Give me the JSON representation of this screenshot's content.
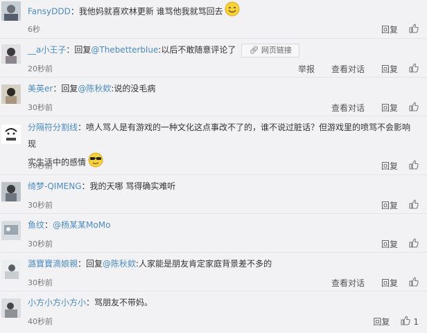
{
  "labels": {
    "reply": "回复",
    "report": "举报",
    "view_conversation": "查看对话"
  },
  "comments": [
    {
      "user": "FansyDDD",
      "text": "：我他妈就喜欢林更新 谁骂他我就骂回去",
      "time": "6秒",
      "emoji": "smile-emoji-icon"
    },
    {
      "user": "__a小王子",
      "prefix": "：回复",
      "mention": "@Thebetterblue",
      "text": ":以后不敢随意评论了",
      "link_label": "网页链接",
      "time": "20秒前"
    },
    {
      "user": "美英er",
      "prefix": "：回复",
      "mention": "@陈秋欸",
      "text": ":说的没毛病",
      "time": "30秒前"
    },
    {
      "user": "分隔符分割线",
      "text_line1": "：喷人骂人是有游戏的一种文化这点事改不了的，谁不说过脏话？但游戏里的喷骂不会影响现",
      "text_line2": "实生活中的感情",
      "emoji": "sunglasses-emoji-icon",
      "time": "30秒前"
    },
    {
      "user": "绮梦-QIMENG",
      "text": "：我的天哪 骂得确实难听",
      "time": "30秒前"
    },
    {
      "user": "鱼纹",
      "prefix": "：",
      "mention": "@杨某某MoMo",
      "time": "30秒前"
    },
    {
      "user": "潞寶寶滴娘親",
      "prefix": "：回复",
      "mention": "@陈秋欸",
      "text": ":人家能是朋友肯定家庭背景差不多的",
      "time": "30秒前"
    },
    {
      "user": "小方小方小方小",
      "text": "：骂朋友不带妈。",
      "time": "40秒前",
      "likes": "1"
    }
  ]
}
